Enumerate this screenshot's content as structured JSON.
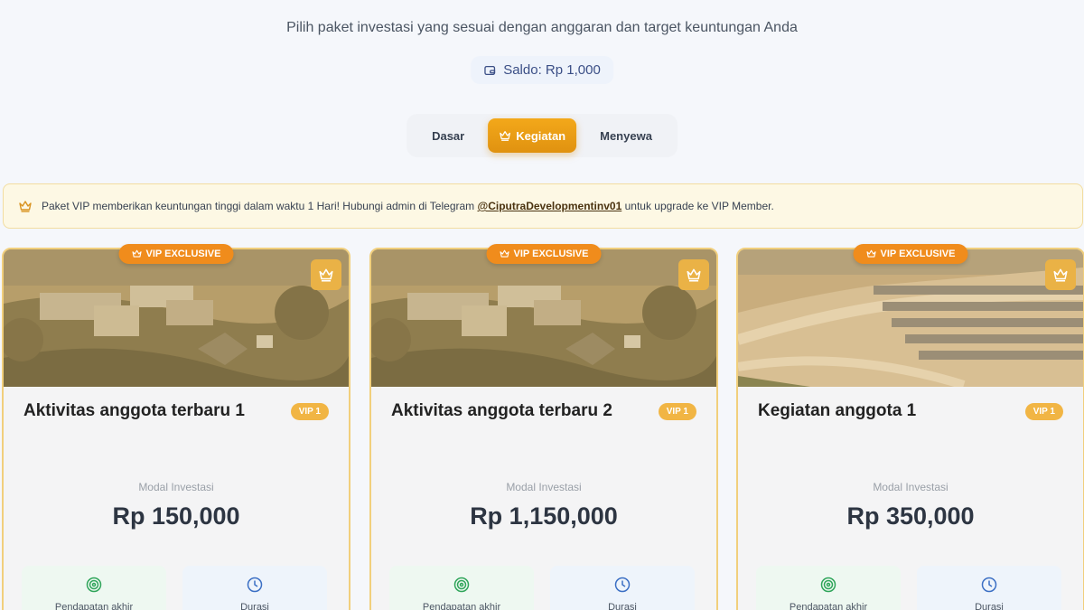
{
  "header": {
    "subtitle": "Pilih paket investasi yang sesuai dengan anggaran dan target keuntungan Anda",
    "balance_label": "Saldo: Rp 1,000",
    "balance_icon": "wallet-icon"
  },
  "tabs": [
    {
      "label": "Dasar",
      "active": false
    },
    {
      "label": "Kegiatan",
      "active": true,
      "icon": "crown-icon"
    },
    {
      "label": "Menyewa",
      "active": false
    }
  ],
  "notice": {
    "text_before": "Paket VIP memberikan keuntungan tinggi dalam waktu 1 Hari! Hubungi admin di Telegram",
    "telegram_handle": "@CiputraDevelopmentinv01",
    "text_after": "untuk upgrade ke VIP Member.",
    "icon": "crown-icon"
  },
  "cards": [
    {
      "ribbon": "VIP EXCLUSIVE",
      "title": "Aktivitas anggota terbaru 1",
      "vip_level": "VIP 1",
      "modal_label": "Modal Investasi",
      "price": "Rp 150,000",
      "stat_income_label": "Pendapatan akhir",
      "stat_duration_label": "Durasi"
    },
    {
      "ribbon": "VIP EXCLUSIVE",
      "title": "Aktivitas anggota terbaru 2",
      "vip_level": "VIP 1",
      "modal_label": "Modal Investasi",
      "price": "Rp 1,150,000",
      "stat_income_label": "Pendapatan akhir",
      "stat_duration_label": "Durasi"
    },
    {
      "ribbon": "VIP EXCLUSIVE",
      "title": "Kegiatan anggota 1",
      "vip_level": "VIP 1",
      "modal_label": "Modal Investasi",
      "price": "Rp 350,000",
      "stat_income_label": "Pendapatan akhir",
      "stat_duration_label": "Durasi"
    }
  ],
  "colors": {
    "accent": "#f08c1c",
    "tab_active": "#e8a015",
    "card_border": "#f1cf7c",
    "notice_bg": "#fdf8e4"
  }
}
